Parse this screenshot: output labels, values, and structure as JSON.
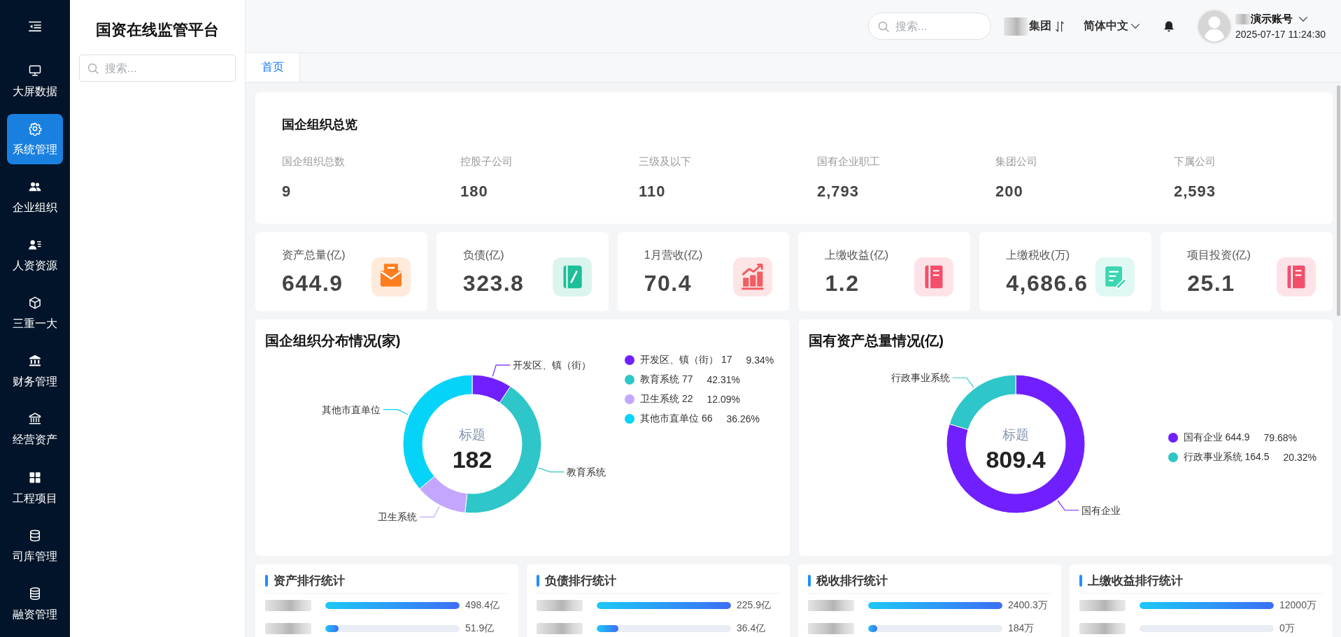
{
  "nav": {
    "items": [
      {
        "label": "大屏数据",
        "selected": false
      },
      {
        "label": "系统管理",
        "selected": true
      },
      {
        "label": "企业组织",
        "selected": false
      },
      {
        "label": "人资资源",
        "selected": false
      },
      {
        "label": "三重一大",
        "selected": false
      },
      {
        "label": "财务管理",
        "selected": false
      },
      {
        "label": "经营资产",
        "selected": false
      },
      {
        "label": "工程项目",
        "selected": false
      },
      {
        "label": "司库管理",
        "selected": false
      },
      {
        "label": "融资管理",
        "selected": false
      }
    ]
  },
  "tree_panel": {
    "title": "国资在线监管平台",
    "search": {
      "placeholder": "搜索..."
    }
  },
  "header": {
    "search": {
      "placeholder": "搜索..."
    },
    "org": "集团",
    "language": "简体中文",
    "user": {
      "name": "演示账号",
      "time": "2025-07-17 11:24:30"
    }
  },
  "tabs": [
    {
      "label": "首页",
      "selected": true
    }
  ],
  "overview": {
    "title": "国企组织总览",
    "items": [
      {
        "label": "国企组织总数",
        "value": "9"
      },
      {
        "label": "控股子公司",
        "value": "180"
      },
      {
        "label": "三级及以下",
        "value": "110"
      },
      {
        "label": "国有企业职工",
        "value": "2,793"
      },
      {
        "label": "集团公司",
        "value": "200"
      },
      {
        "label": "下属公司",
        "value": "2,593"
      }
    ]
  },
  "stats": [
    {
      "label": "资产总量(亿)",
      "value": "644.9",
      "color": "#ff7d1f"
    },
    {
      "label": "负债(亿)",
      "value": "323.8",
      "color": "#1ebf98"
    },
    {
      "label": "1月营收(亿)",
      "value": "70.4",
      "color": "#f25c62"
    },
    {
      "label": "上缴收益(亿)",
      "value": "1.2",
      "color": "#f24f6b"
    },
    {
      "label": "上缴税收(万)",
      "value": "4,686.6",
      "color": "#3dd6b2"
    },
    {
      "label": "项目投资(亿)",
      "value": "25.1",
      "color": "#f24f6b"
    }
  ],
  "charts": [
    {
      "chart_data": {
        "type": "donut",
        "title": "国企组织分布情况(家)",
        "categories": [
          "开发区、镇（街）",
          "教育系统",
          "卫生系统",
          "其他市直单位"
        ],
        "values": [
          9.34,
          42.31,
          12.09,
          36.26
        ]
      },
      "center": {
        "title": "标题",
        "value": "182"
      },
      "legend": [
        {
          "label": "开发区、镇（街） 17",
          "percent": "9.34%",
          "color": "#7020fe"
        },
        {
          "label": "教育系统 77",
          "percent": "42.31%",
          "color": "#2ec6c8"
        },
        {
          "label": "卫生系统 22",
          "percent": "12.09%",
          "color": "#c3a6fd"
        },
        {
          "label": "其他市直单位 66",
          "percent": "36.26%",
          "color": "#05d3f8"
        }
      ]
    },
    {
      "chart_data": {
        "type": "donut",
        "title": "国有资产总量情况(亿)",
        "categories": [
          "国有企业",
          "行政事业系统"
        ],
        "values": [
          79.68,
          20.32
        ]
      },
      "center": {
        "title": "标题",
        "value": "809.4"
      },
      "legend": [
        {
          "label": "国有企业 644.9",
          "percent": "79.68%",
          "color": "#7020fe"
        },
        {
          "label": "行政事业系统 164.5",
          "percent": "20.32%",
          "color": "#2ec6c8"
        }
      ]
    }
  ],
  "rankings": [
    {
      "title": "资产排行统计",
      "rows": [
        {
          "value": "498.4亿",
          "level": 1
        },
        {
          "value": "51.9亿",
          "level": 0.1
        }
      ]
    },
    {
      "title": "负债排行统计",
      "rows": [
        {
          "value": "225.9亿",
          "level": 1
        },
        {
          "value": "36.4亿",
          "level": 0.16
        }
      ]
    },
    {
      "title": "税收排行统计",
      "rows": [
        {
          "value": "2400.3万",
          "level": 1
        },
        {
          "value": "184万",
          "level": 0.07
        }
      ]
    },
    {
      "title": "上缴收益排行统计",
      "rows": [
        {
          "value": "12000万",
          "level": 1
        },
        {
          "value": "0万"
        }
      ]
    }
  ]
}
